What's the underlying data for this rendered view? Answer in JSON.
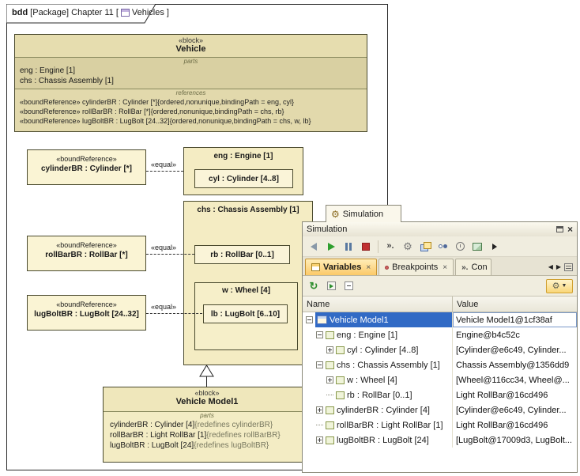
{
  "frame": {
    "kind": "bdd",
    "context": "[Package] Chapter 11 [",
    "diagram_name": "Vehicles",
    "bracket": "]"
  },
  "vehicle": {
    "stereotype": "«block»",
    "name": "Vehicle",
    "parts_label": "parts",
    "parts": [
      "eng : Engine [1]",
      "chs : Chassis Assembly [1]"
    ],
    "references_label": "references",
    "references": [
      "«boundReference» cylinderBR : Cylinder [*]{ordered,nonunique,bindingPath = eng, cyl}",
      "«boundReference» rollBarBR : RollBar [*]{ordered,nonunique,bindingPath = chs, rb}",
      "«boundReference» lugBoltBR : LugBolt [24..32]{ordered,nonunique,bindingPath = chs, w, lb}"
    ]
  },
  "bound_refs": [
    {
      "stereotype": "«boundReference»",
      "name": "cylinderBR : Cylinder [*]"
    },
    {
      "stereotype": "«boundReference»",
      "name": "rollBarBR : RollBar [*]"
    },
    {
      "stereotype": "«boundReference»",
      "name": "lugBoltBR : LugBolt [24..32]"
    }
  ],
  "equal_label": "«equal»",
  "eng": {
    "title": "eng : Engine [1]",
    "inner": "cyl : Cylinder [4..8]"
  },
  "chs": {
    "title": "chs : Chassis Assembly [1]",
    "rb": "rb : RollBar [0..1]",
    "w": "w : Wheel [4]",
    "lb": "lb : LugBolt [6..10]"
  },
  "model1": {
    "stereotype": "«block»",
    "name": "Vehicle Model1",
    "parts_label": "parts",
    "parts": [
      {
        "text": "cylinderBR : Cylinder [4]",
        "constraint": "{redefines cylinderBR}"
      },
      {
        "text": "rollBarBR : Light RollBar [1]",
        "constraint": "{redefines rollBarBR}"
      },
      {
        "text": "lugBoltBR : LugBolt [24]",
        "constraint": "{redefines lugBoltBR}"
      }
    ]
  },
  "simulation": {
    "doc_tab": "Simulation",
    "title": "Simulation",
    "tabs": [
      {
        "label": "Variables"
      },
      {
        "label": "Breakpoints"
      },
      {
        "label": "Con"
      }
    ],
    "table": {
      "columns": [
        "Name",
        "Value"
      ],
      "rows": [
        {
          "name": "Vehicle Model1",
          "value": "Vehicle Model1@1cf38af"
        },
        {
          "name": "eng : Engine [1]",
          "value": "Engine@b4c52c"
        },
        {
          "name": "cyl : Cylinder [4..8]",
          "value": "[Cylinder@e6c49, Cylinder..."
        },
        {
          "name": "chs : Chassis Assembly [1]",
          "value": "Chassis Assembly@1356dd9"
        },
        {
          "name": "w : Wheel [4]",
          "value": "[Wheel@116cc34, Wheel@..."
        },
        {
          "name": "rb : RollBar [0..1]",
          "value": "Light RollBar@16cd496"
        },
        {
          "name": "cylinderBR : Cylinder [4]",
          "value": "[Cylinder@e6c49, Cylinder..."
        },
        {
          "name": "rollBarBR : Light RollBar [1]",
          "value": "Light RollBar@16cd496"
        },
        {
          "name": "lugBoltBR : LugBolt [24]",
          "value": "[LugBolt@17009d3, LugBolt..."
        }
      ]
    }
  },
  "icons": {
    "gear": "⚙",
    "close": "×",
    "speed": "».",
    "refresh": "↻",
    "arrow_left": "◀",
    "arrow_right": "▶",
    "dropdown": "▼"
  }
}
